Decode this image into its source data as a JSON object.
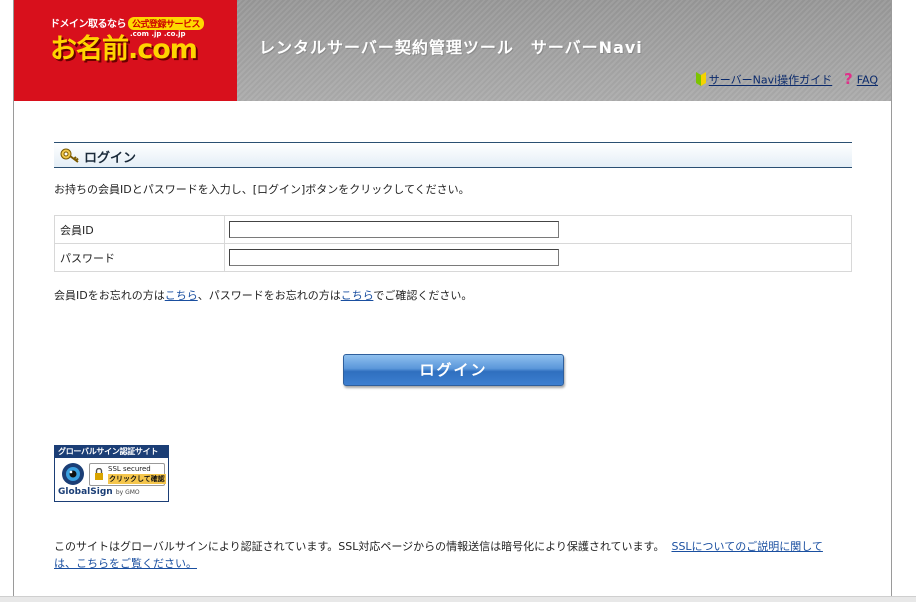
{
  "header": {
    "logo_tagline": "ドメイン取るなら",
    "logo_badge": "公式登録サービス",
    "logo_main": "お名前.com",
    "logo_domains": ".com .jp .co.jp",
    "banner_title": "レンタルサーバー契約管理ツール　サーバーNavi",
    "guide_link": "サーバーNavi操作ガイド",
    "faq_link": "FAQ"
  },
  "login": {
    "section_title": "ログイン",
    "instruction": "お持ちの会員IDとパスワードを入力し、[ログイン]ボタンをクリックしてください。",
    "member_id_label": "会員ID",
    "member_id_value": "",
    "password_label": "パスワード",
    "password_value": "",
    "forgot_prefix": "会員IDをお忘れの方は",
    "forgot_id_link": "こちら",
    "forgot_middle": "、パスワードをお忘れの方は",
    "forgot_pw_link": "こちら",
    "forgot_suffix": "でご確認ください。",
    "login_button": "ログイン"
  },
  "seal": {
    "top_text": "グローバルサイン認証サイト",
    "ssl_line1": "SSL secured",
    "ssl_line2": "クリックして確認",
    "brand": "GlobalSign",
    "brand_by": "by GMO"
  },
  "footer": {
    "ssl_note": "このサイトはグローバルサインにより認証されています。SSL対応ページからの情報送信は暗号化により保護されています。",
    "ssl_link": "SSLについてのご説明に関しては、こちらをご覧ください。"
  },
  "colors": {
    "logo_red": "#d8101c",
    "logo_yellow": "#ffd400",
    "banner_gray": "#8f8f8f",
    "link_blue": "#1a4fa0",
    "button_blue": "#3d7fd0"
  }
}
